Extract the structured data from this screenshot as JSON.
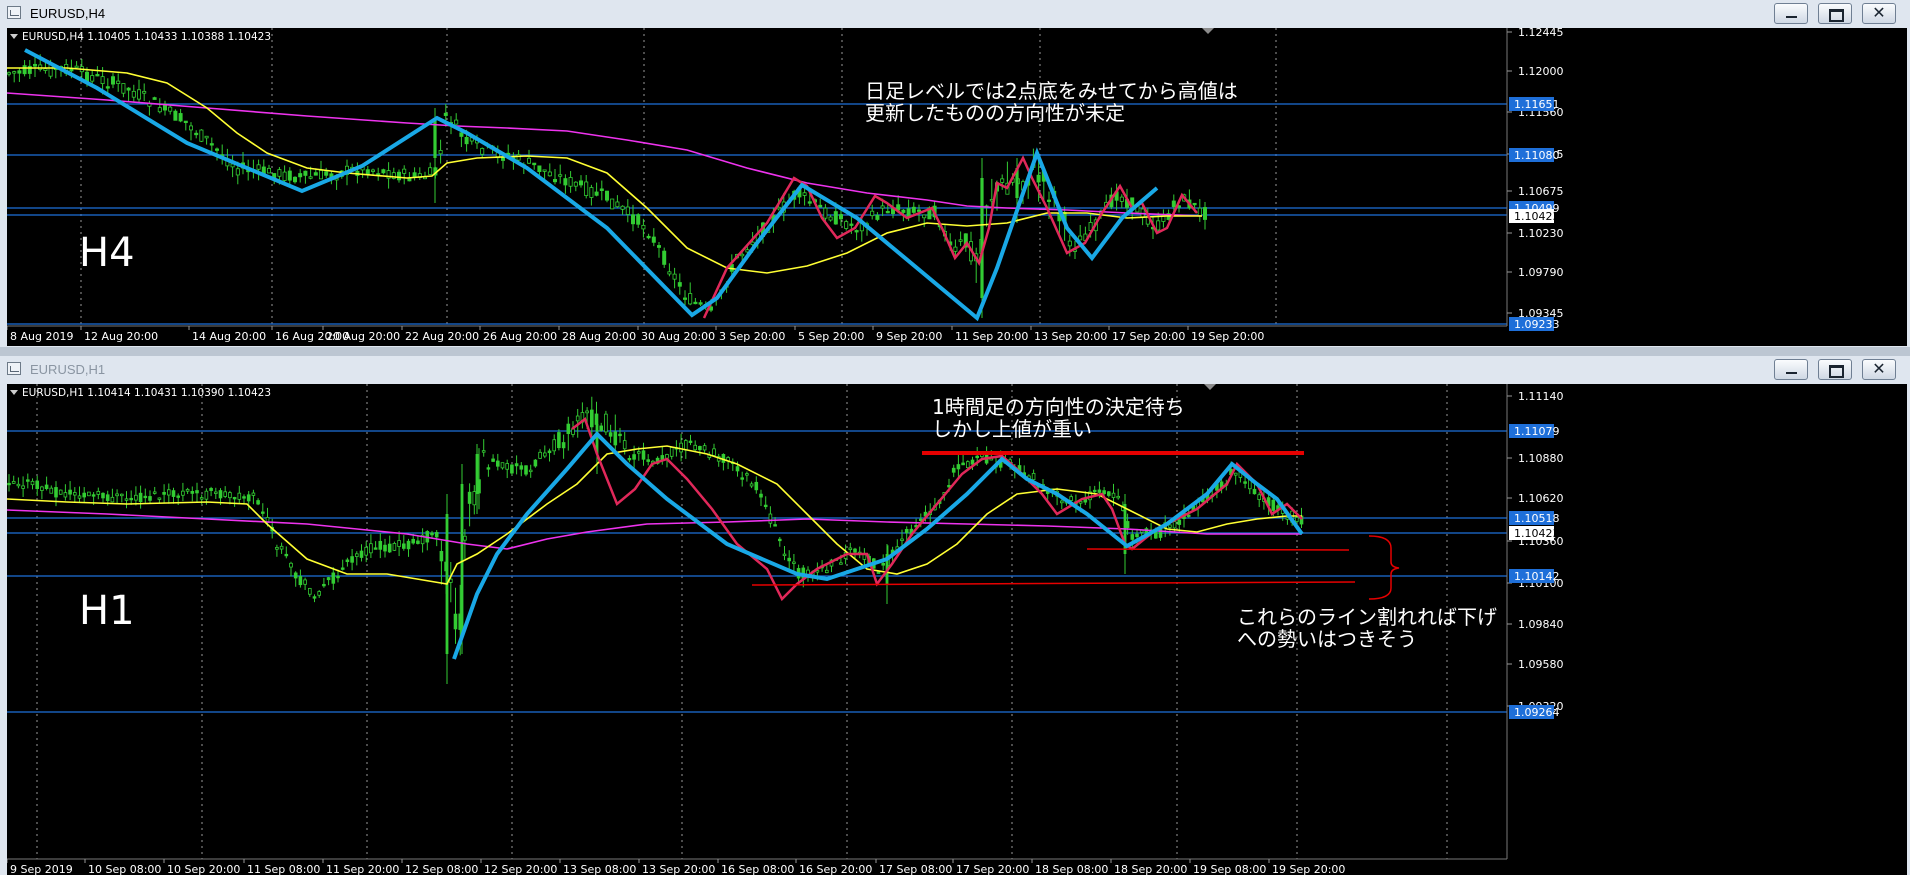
{
  "h4_window": {
    "title": "EURUSD,H4",
    "header": "EURUSD,H4  1.10405 1.10433 1.10388 1.10423",
    "timeframe_label": "H4",
    "annotation_lines": [
      "日足レベルでは2点底をみせてから高値は",
      "更新したものの方向性が未定"
    ],
    "price_ticks": [
      "1.12445",
      "1.12000",
      "1.11560",
      "1.11115",
      "1.10675",
      "1.10230",
      "1.09790",
      "1.09345"
    ],
    "price_tags": [
      "1.11651",
      "1.11080",
      "1.10499",
      "1.10423",
      "1.09233"
    ],
    "time_labels": [
      "8 Aug 2019",
      "12 Aug 20:00",
      "14 Aug 20:00",
      "16 Aug 20:00",
      "20 Aug 20:00",
      "22 Aug 20:00",
      "26 Aug 20:00",
      "28 Aug 20:00",
      "30 Aug 20:00",
      "3 Sep 20:00",
      "5 Sep 20:00",
      "9 Sep 20:00",
      "11 Sep 20:00",
      "13 Sep 20:00",
      "17 Sep 20:00",
      "19 Sep 20:00"
    ]
  },
  "h1_window": {
    "title": "EURUSD,H1",
    "header": "EURUSD,H1  1.10414 1.10431 1.10390 1.10423",
    "timeframe_label": "H1",
    "annotation_top": [
      "1時間足の方向性の決定待ち",
      "しかし上値が重い"
    ],
    "annotation_bottom": [
      "これらのライン割れれば下げ",
      "への勢いはつきそう"
    ],
    "price_ticks": [
      "1.11140",
      "1.10880",
      "1.10620",
      "1.10360",
      "1.10100",
      "1.09840",
      "1.09580",
      "1.09320"
    ],
    "price_tags": [
      "1.11079",
      "1.10518",
      "1.10423",
      "1.10142",
      "1.09264"
    ],
    "time_labels": [
      "9 Sep 2019",
      "10 Sep 08:00",
      "10 Sep 20:00",
      "11 Sep 08:00",
      "11 Sep 20:00",
      "12 Sep 08:00",
      "12 Sep 20:00",
      "13 Sep 08:00",
      "13 Sep 20:00",
      "16 Sep 08:00",
      "16 Sep 20:00",
      "17 Sep 08:00",
      "17 Sep 20:00",
      "18 Sep 08:00",
      "18 Sep 20:00",
      "19 Sep 08:00",
      "19 Sep 20:00"
    ]
  },
  "controls": {
    "minimize": "minimize",
    "maximize": "maximize",
    "close": "✕"
  },
  "colors": {
    "background": "#000000",
    "candle": "#33cc33",
    "fast_ma": "#ffff33",
    "slow_ma": "#ee33ee",
    "trend_blue": "#19a8e6",
    "trend_red": "#e0285a",
    "level": "#1e6fd9",
    "tag": "#1e6fd9",
    "support": "#e60000"
  }
}
